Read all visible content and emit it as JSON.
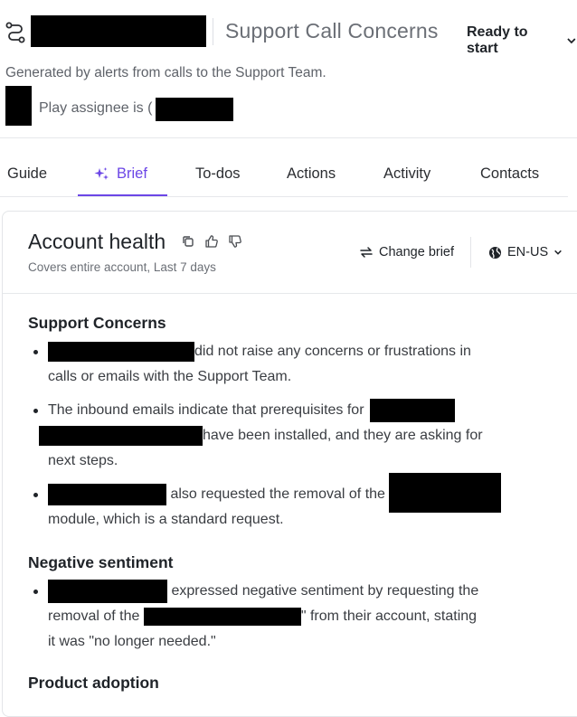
{
  "header": {
    "play_title": "Support Call Concerns",
    "status": "Ready to start",
    "subtitle": "Generated by alerts from calls to the Support Team.",
    "assignee_prefix": "Play assignee is ("
  },
  "tabs": [
    {
      "label": "Guide"
    },
    {
      "label": "Brief",
      "active": true
    },
    {
      "label": "To-dos"
    },
    {
      "label": "Actions"
    },
    {
      "label": "Activity"
    },
    {
      "label": "Contacts"
    }
  ],
  "brief": {
    "title": "Account health",
    "coverage": "Covers entire account, Last 7 days",
    "change_brief": "Change brief",
    "language": "EN-US",
    "sections": [
      {
        "title": "Support Concerns",
        "bullets": [
          {
            "parts": [
              "did not raise any concerns or frustrations in",
              "calls or emails with the Support Team."
            ]
          },
          {
            "parts": [
              "The inbound emails indicate that prerequisites for",
              "have been installed, and they are asking for",
              "next steps."
            ]
          },
          {
            "parts": [
              "also requested the removal of the",
              "module, which is a standard request."
            ]
          }
        ]
      },
      {
        "title": "Negative sentiment",
        "bullets": [
          {
            "parts": [
              "expressed negative sentiment by requesting the",
              "removal of the",
              "\" from their account, stating",
              "it was \"no longer needed.\""
            ]
          }
        ]
      },
      {
        "title": "Product adoption",
        "bullets": []
      }
    ]
  },
  "colors": {
    "accent": "#6b46e6",
    "text": "#1f2328",
    "muted": "#6b6f76",
    "redaction": "#000000"
  },
  "icons": [
    "route-icon",
    "chevron-down-icon",
    "sparkle-icon",
    "copy-icon",
    "thumbs-up-icon",
    "thumbs-down-icon",
    "swap-icon",
    "globe-icon"
  ]
}
